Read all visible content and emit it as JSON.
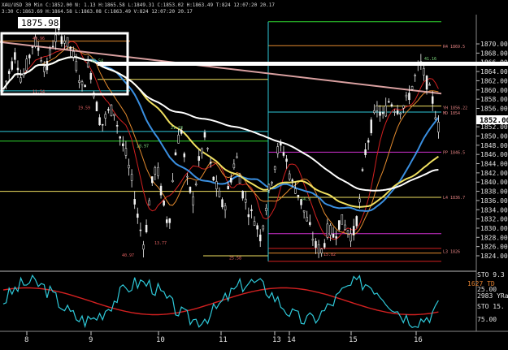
{
  "header": {
    "line1": "XAU/USD 30 Min  C:1852.00  N: 1.13  H:1865.58  L:1849.31  C:1853.02  H:1863.49  T:824  12:07:20  20.17",
    "line2": "3:30  C:1863.69  H:1864.58  L:1863.08  C:1863.49  V:824  12:07:20  20.17",
    "box_label": "1875.98"
  },
  "colors": {
    "background": "#000000",
    "candle": "#f2f2f2",
    "ma_red": "#d22020",
    "ma_orange": "#e38a2e",
    "ma_blue": "#3a8fe0",
    "ma_yellow": "#f0e060",
    "ma_white": "#ffffff",
    "ma_pink": "#d9a0a0",
    "cyan": "#2ec8d8",
    "green": "#2fd62f",
    "magenta": "#d030d0",
    "price_label_bg": "#ffffff",
    "price_label_fg": "#000000"
  },
  "chart_data": {
    "type": "candlestick",
    "symbol": "XAU/USD",
    "timeframe": "30 Min",
    "ylim": [
      1821,
      1876
    ],
    "y_ticks": [
      1824,
      1826,
      1828,
      1830,
      1832,
      1834,
      1836,
      1838,
      1840,
      1842,
      1844,
      1846,
      1848,
      1850,
      1852,
      1854,
      1856,
      1858,
      1860,
      1862,
      1864,
      1866,
      1868,
      1870
    ],
    "y_tick_labels": [
      "1824.00",
      "1826.00",
      "1828.00",
      "1830.00",
      "1832.00",
      "1834.00",
      "1836.00",
      "1838.00",
      "1840.00",
      "1842.00",
      "1844.00",
      "1846.00",
      "1848.00",
      "1850.00",
      "1852.00",
      "1854.00",
      "1856.00",
      "1858.00",
      "1860.00",
      "1862.00",
      "1864.00",
      "1866.00",
      "1868.00",
      "1870.00"
    ],
    "x_labels": [
      "8",
      "9",
      "10",
      "11",
      "13",
      "14",
      "15",
      "16"
    ],
    "last_price": "1852.00",
    "ohlc_path": [
      1860,
      1864,
      1868,
      1862,
      1866,
      1871,
      1868,
      1864,
      1870,
      1872,
      1871,
      1869,
      1865,
      1860,
      1866,
      1858,
      1852,
      1855,
      1856,
      1850,
      1846,
      1840,
      1832,
      1826,
      1838,
      1844,
      1836,
      1830,
      1846,
      1852,
      1840,
      1836,
      1845,
      1850,
      1842,
      1838,
      1834,
      1840,
      1846,
      1838,
      1834,
      1832,
      1828,
      1836,
      1842,
      1848,
      1846,
      1840,
      1838,
      1834,
      1830,
      1826,
      1825,
      1830,
      1828,
      1832,
      1830,
      1828,
      1834,
      1846,
      1852,
      1856,
      1854,
      1858,
      1856,
      1856,
      1858,
      1862,
      1866,
      1862,
      1858,
      1852
    ],
    "annotations": [
      {
        "text": "41.16",
        "price": 1866.5
      },
      {
        "text": "10.54",
        "price": 1866.0
      },
      {
        "text": "21.23",
        "price": 1851.5
      },
      {
        "text": "18.97",
        "price": 1847.5
      },
      {
        "text": "14.9",
        "price": 1836.0
      },
      {
        "text": "11.54",
        "price": 1859.3
      },
      {
        "text": "19.59",
        "price": 1855.8
      },
      {
        "text": "40.97",
        "price": 1823.8
      },
      {
        "text": "13.77",
        "price": 1826.5
      },
      {
        "text": "25.58",
        "price": 1823.2
      },
      {
        "text": "15.82",
        "price": 1824.0
      },
      {
        "text": "40.96",
        "price": 1870.9
      }
    ],
    "level_labels": [
      {
        "text": "R4 1869.5",
        "price": 1869.5
      },
      {
        "text": "YH 1856.22",
        "price": 1856.2
      },
      {
        "text": "MD 1854",
        "price": 1855.0
      },
      {
        "text": "PP 1846.5",
        "price": 1846.5
      },
      {
        "text": "L4 1836.7",
        "price": 1836.7
      },
      {
        "text": "L3 1826",
        "price": 1825.0
      }
    ],
    "oscillator": {
      "labels": [
        "STO  9.3",
        "1627 TD",
        "25.00",
        "2983 YRange",
        "STO  15.",
        "75.00"
      ]
    }
  }
}
